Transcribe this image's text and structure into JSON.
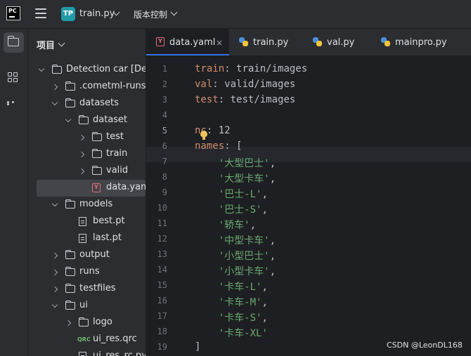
{
  "titlebar": {
    "logo_text": "PC",
    "project_badge": "TP",
    "project_name": "train.py",
    "vcs_label": "版本控制"
  },
  "toolstrip": {
    "icons": [
      "folder-icon",
      "structure-icon",
      "more-icon"
    ]
  },
  "project_panel": {
    "title": "项目",
    "tree": [
      {
        "label": "Detection car [Dete",
        "type": "folder",
        "open": true,
        "depth": 0
      },
      {
        "label": ".cometml-runs",
        "type": "folder",
        "open": false,
        "depth": 1
      },
      {
        "label": "datasets",
        "type": "folder",
        "open": true,
        "depth": 1
      },
      {
        "label": "dataset",
        "type": "folder",
        "open": true,
        "depth": 2
      },
      {
        "label": "test",
        "type": "folder",
        "open": false,
        "depth": 3
      },
      {
        "label": "train",
        "type": "folder",
        "open": false,
        "depth": 3
      },
      {
        "label": "valid",
        "type": "folder",
        "open": false,
        "depth": 3
      },
      {
        "label": "data.yaml",
        "type": "yaml",
        "depth": 3,
        "selected": true
      },
      {
        "label": "models",
        "type": "folder",
        "open": true,
        "depth": 1
      },
      {
        "label": "best.pt",
        "type": "file",
        "depth": 2
      },
      {
        "label": "last.pt",
        "type": "file",
        "depth": 2
      },
      {
        "label": "output",
        "type": "folder",
        "open": false,
        "depth": 1
      },
      {
        "label": "runs",
        "type": "folder",
        "open": false,
        "depth": 1
      },
      {
        "label": "testfiles",
        "type": "folder",
        "open": false,
        "depth": 1
      },
      {
        "label": "ui",
        "type": "folder",
        "open": true,
        "depth": 1
      },
      {
        "label": "logo",
        "type": "folder",
        "open": false,
        "depth": 2
      },
      {
        "label": "ui_res.qrc",
        "type": "qrc",
        "depth": 2
      },
      {
        "label": "ui_res_rc.py",
        "type": "file",
        "depth": 2
      }
    ]
  },
  "tabs": [
    {
      "label": "data.yaml",
      "icon": "yaml-icon",
      "active": true,
      "close": "×"
    },
    {
      "label": "train.py",
      "icon": "python-icon",
      "active": false
    },
    {
      "label": "val.py",
      "icon": "python-icon",
      "active": false
    },
    {
      "label": "mainpro.py",
      "icon": "python-icon",
      "active": false
    }
  ],
  "editor": {
    "current_line": 5,
    "lines": [
      {
        "n": "1",
        "key": "train",
        "val": " train/images"
      },
      {
        "n": "2",
        "key": "val",
        "val": " valid/images"
      },
      {
        "n": "3",
        "key": "test",
        "val": " test/images"
      },
      {
        "n": "4",
        "key": "",
        "val": ""
      },
      {
        "n": "5",
        "key": "nc",
        "val": " 12"
      },
      {
        "n": "6",
        "key": "names",
        "val": " ["
      },
      {
        "n": "7",
        "str": "'大型巴士'",
        "tail": ","
      },
      {
        "n": "8",
        "str": "'大型卡车'",
        "tail": ","
      },
      {
        "n": "9",
        "str": "'巴士-L'",
        "tail": ","
      },
      {
        "n": "10",
        "str": "'巴士-S'",
        "tail": ","
      },
      {
        "n": "11",
        "str": "'轿车'",
        "tail": ","
      },
      {
        "n": "12",
        "str": "'中型卡车'",
        "tail": ","
      },
      {
        "n": "13",
        "str": "'小型巴士'",
        "tail": ","
      },
      {
        "n": "14",
        "str": "'小型卡车'",
        "tail": ","
      },
      {
        "n": "15",
        "str": "'卡车-L'",
        "tail": ","
      },
      {
        "n": "16",
        "str": "'卡车-M'",
        "tail": ","
      },
      {
        "n": "17",
        "str": "'卡车-S'",
        "tail": ","
      },
      {
        "n": "18",
        "str": "'卡车-XL'",
        "tail": ""
      },
      {
        "n": "19",
        "key": "",
        "val": "]"
      }
    ]
  },
  "watermark": "CSDN @LeonDL168",
  "colors": {
    "accent": "#3574f0",
    "keyword": "#cf8e6d",
    "string": "#6aab73",
    "text": "#bcbec4",
    "panel_bg": "#2b2d30",
    "editor_bg": "#1e1f22"
  }
}
